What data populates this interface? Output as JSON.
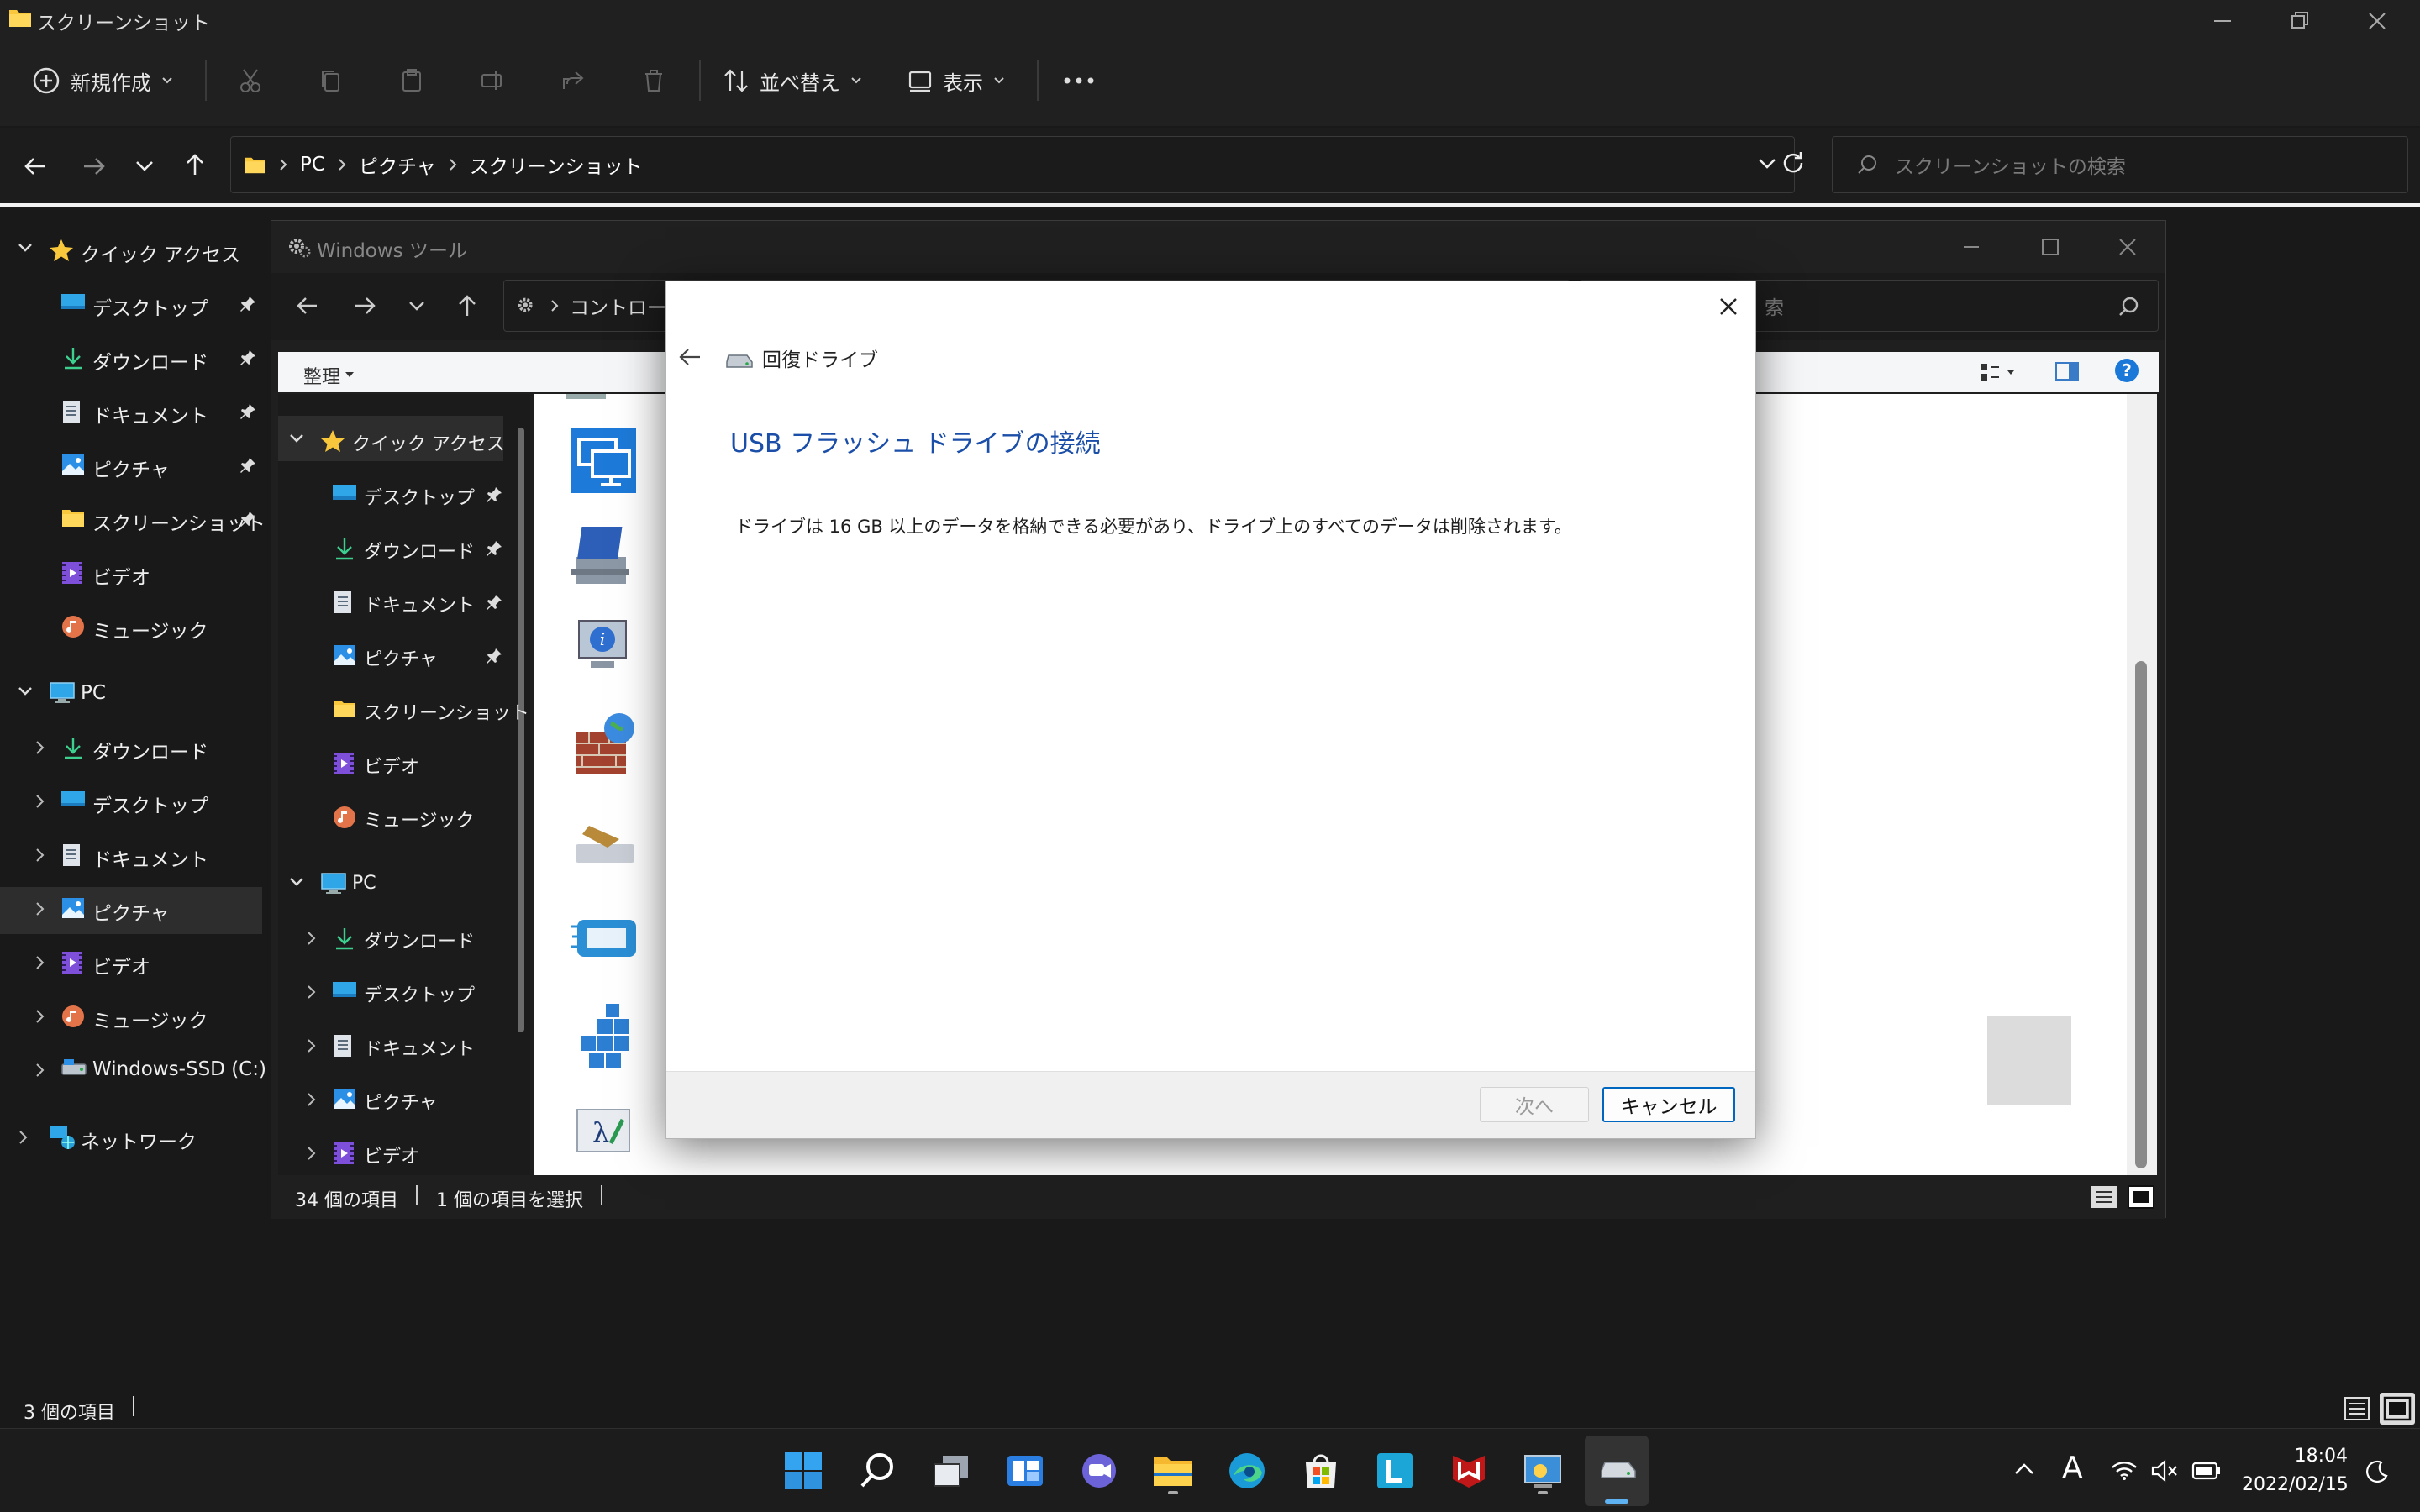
{
  "outer_window": {
    "title": "スクリーンショット",
    "toolbar": {
      "new_label": "新規作成",
      "sort_label": "並べ替え",
      "view_label": "表示"
    },
    "breadcrumb": [
      "PC",
      "ピクチャ",
      "スクリーンショット"
    ],
    "search_placeholder": "スクリーンショットの検索",
    "nav": {
      "quick_access": "クイック アクセス",
      "quick_items": [
        "デスクトップ",
        "ダウンロード",
        "ドキュメント",
        "ピクチャ",
        "スクリーンショット",
        "ビデオ",
        "ミュージック"
      ],
      "pc": "PC",
      "pc_items": [
        "ダウンロード",
        "デスクトップ",
        "ドキュメント",
        "ピクチャ",
        "ビデオ",
        "ミュージック",
        "Windows-SSD (C:)"
      ],
      "network": "ネットワーク"
    },
    "status": "3 個の項目"
  },
  "inner_window": {
    "title": "Windows ツール",
    "address": "コントロール",
    "search_placeholder": "索",
    "organize_label": "整理",
    "nav": {
      "quick_access": "クイック アクセス",
      "quick_items": [
        "デスクトップ",
        "ダウンロード",
        "ドキュメント",
        "ピクチャ",
        "スクリーンショット",
        "ビデオ",
        "ミュージック"
      ],
      "pc": "PC",
      "pc_items": [
        "ダウンロード",
        "デスクトップ",
        "ドキュメント",
        "ピクチャ",
        "ビデオ"
      ]
    },
    "status_count": "34 個の項目",
    "status_selected": "1 個の項目を選択"
  },
  "dialog": {
    "app_name": "回復ドライブ",
    "heading": "USB フラッシュ ドライブの接続",
    "body": "ドライブは 16 GB 以上のデータを格納できる必要があり、ドライブ上のすべてのデータは削除されます。",
    "next_label": "次へ",
    "cancel_label": "キャンセル"
  },
  "taskbar": {
    "time": "18:04",
    "date": "2022/02/15",
    "ime": "A"
  },
  "colors": {
    "accent": "#0067c0",
    "heading_blue": "#1a4ea8",
    "folder_yellow": "#f8c73b",
    "dark_bg": "#191919"
  }
}
